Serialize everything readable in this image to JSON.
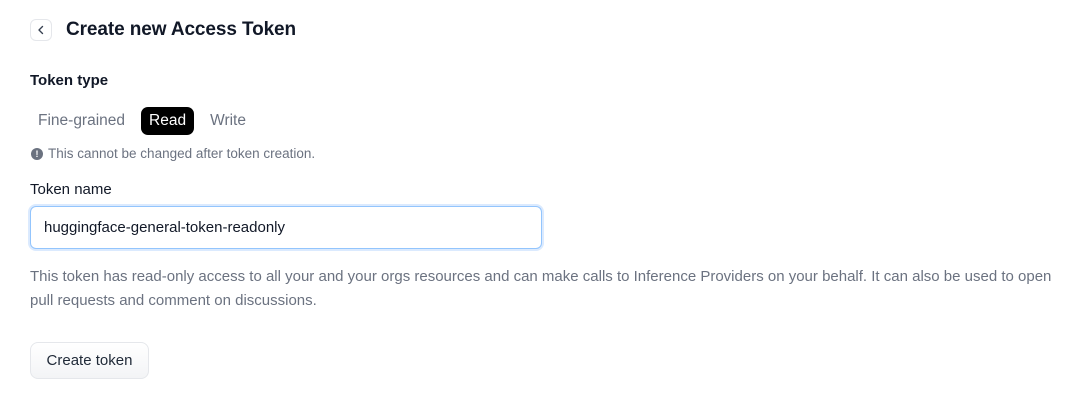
{
  "header": {
    "back_icon": "chevron-left-icon",
    "title": "Create new Access Token"
  },
  "token_type": {
    "label": "Token type",
    "options": [
      "Fine-grained",
      "Read",
      "Write"
    ],
    "selected": "Read",
    "note_icon": "info-icon",
    "note": "This cannot be changed after token creation."
  },
  "token_name": {
    "label": "Token name",
    "value": "huggingface-general-token-readonly"
  },
  "description": "This token has read-only access to all your and your orgs resources and can make calls to Inference Providers on your behalf. It can also be used to open pull requests and comment on discussions.",
  "actions": {
    "create_label": "Create token"
  },
  "colors": {
    "selected_bg": "#000000",
    "muted_text": "#6b7280",
    "focus_border": "#93c5fd"
  }
}
